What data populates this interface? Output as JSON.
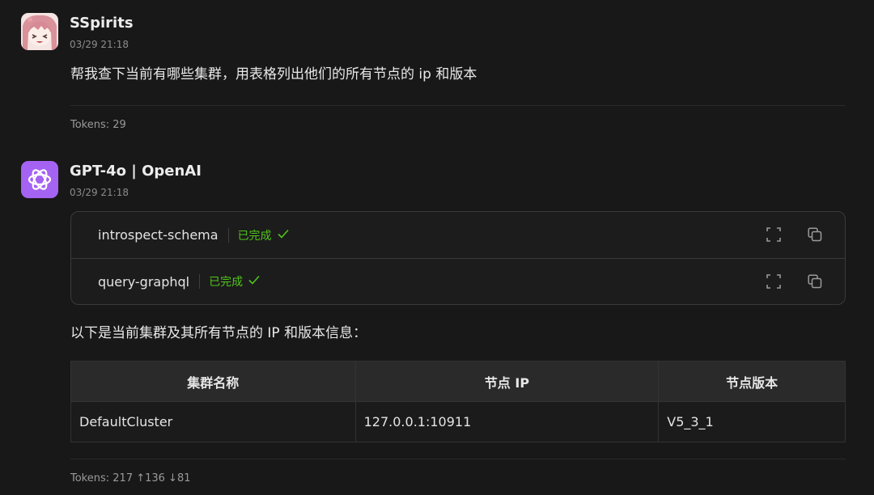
{
  "user_message": {
    "sender": "SSpirits",
    "time": "03/29 21:18",
    "text": "帮我查下当前有哪些集群，用表格列出他们的所有节点的 ip 和版本",
    "tokens": "Tokens: 29"
  },
  "assistant_message": {
    "sender": "GPT-4o | OpenAI",
    "time": "03/29 21:18",
    "tool_calls": [
      {
        "name": "introspect-schema",
        "status": "已完成"
      },
      {
        "name": "query-graphql",
        "status": "已完成"
      }
    ],
    "intro": "以下是当前集群及其所有节点的 IP 和版本信息：",
    "table": {
      "headers": [
        "集群名称",
        "节点 IP",
        "节点版本"
      ],
      "rows": [
        [
          "DefaultCluster",
          "127.0.0.1:10911",
          "V5_3_1"
        ]
      ]
    },
    "tokens": "Tokens: 217 ↑136 ↓81"
  },
  "colors": {
    "background": "#181818",
    "status_done": "#52c41a",
    "openai_avatar": "#a463f2"
  },
  "icons": [
    "anime-avatar",
    "openai-logo-icon",
    "check-icon",
    "expand-icon",
    "copy-icon"
  ]
}
